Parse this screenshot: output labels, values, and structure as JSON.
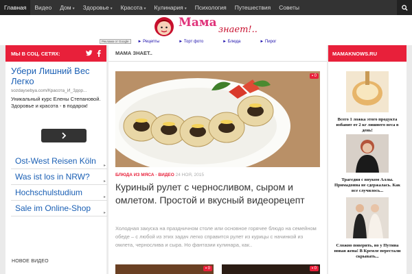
{
  "nav": {
    "items": [
      {
        "label": "Главная",
        "active": true,
        "caret": false
      },
      {
        "label": "Видео",
        "active": false,
        "caret": false
      },
      {
        "label": "Дом",
        "active": false,
        "caret": true
      },
      {
        "label": "Здоровье",
        "active": false,
        "caret": true
      },
      {
        "label": "Красота",
        "active": false,
        "caret": true
      },
      {
        "label": "Кулинария",
        "active": false,
        "caret": true
      },
      {
        "label": "Психология",
        "active": false,
        "caret": false
      },
      {
        "label": "Путешествия",
        "active": false,
        "caret": false
      },
      {
        "label": "Советы",
        "active": false,
        "caret": false
      }
    ],
    "search_icon": "search-icon"
  },
  "logo": {
    "text1": "Мама",
    "text2": "знает!.."
  },
  "adbar": {
    "google_label": "Реклама от Google",
    "links": [
      "► Рецепты",
      "► Торт фото",
      "► Блюда",
      "► Пирог"
    ]
  },
  "left_sidebar": {
    "heading": "МЫ В СОЦ. СЕТЯХ:",
    "ad": {
      "title": "Убери Лишний Вес Легко",
      "url": "sozdaysebya.com/Красота_И_Здор...",
      "desc": "Уникальный курс Елены Степановой. Здоровье и красота - в подарок!"
    },
    "ad_links": [
      "Ost-West Reisen Köln",
      "Was ist los in NRW?",
      "Hochschulstudium",
      "Sale im Online-Shop"
    ],
    "footer_heading": "НОВОЕ ВИДЕО"
  },
  "main": {
    "heading": "МАМА ЗНАЕТ..",
    "comment_count": "0",
    "category": "БЛЮДА ИЗ МЯСА · ВИДЕО",
    "date": "24 НОЯ, 2015",
    "title": "Куриный рулет с черносливом, сыром и омлетом. Простой и вкусный видеорецепт",
    "excerpt": "Холодная закуска на праздничном столе или основное горячее блюдо на семейном обеде – с любой из этих задач легко справится рулет из курицы с начинкой из омлета, чернослива и сыра. Но фантазии кулинара, как..",
    "thumb_comments": [
      "0",
      "0"
    ]
  },
  "right_sidebar": {
    "heading": "MAMAKNOWS.RU",
    "cards": [
      {
        "caption": "Всего 1 ложка этого продукта избавит от 2 кг лишнего веса в день!"
      },
      {
        "caption": "Трагедия с внуком Аллы. Примадонна не сдержалась. Как все случилось..."
      },
      {
        "caption": "Сложно поверить, но у Путина новая жена! В Кремле перестали скрывать..."
      }
    ]
  },
  "colors": {
    "accent": "#e8203a",
    "nav_bg": "#333333",
    "link": "#1a5fb4"
  }
}
